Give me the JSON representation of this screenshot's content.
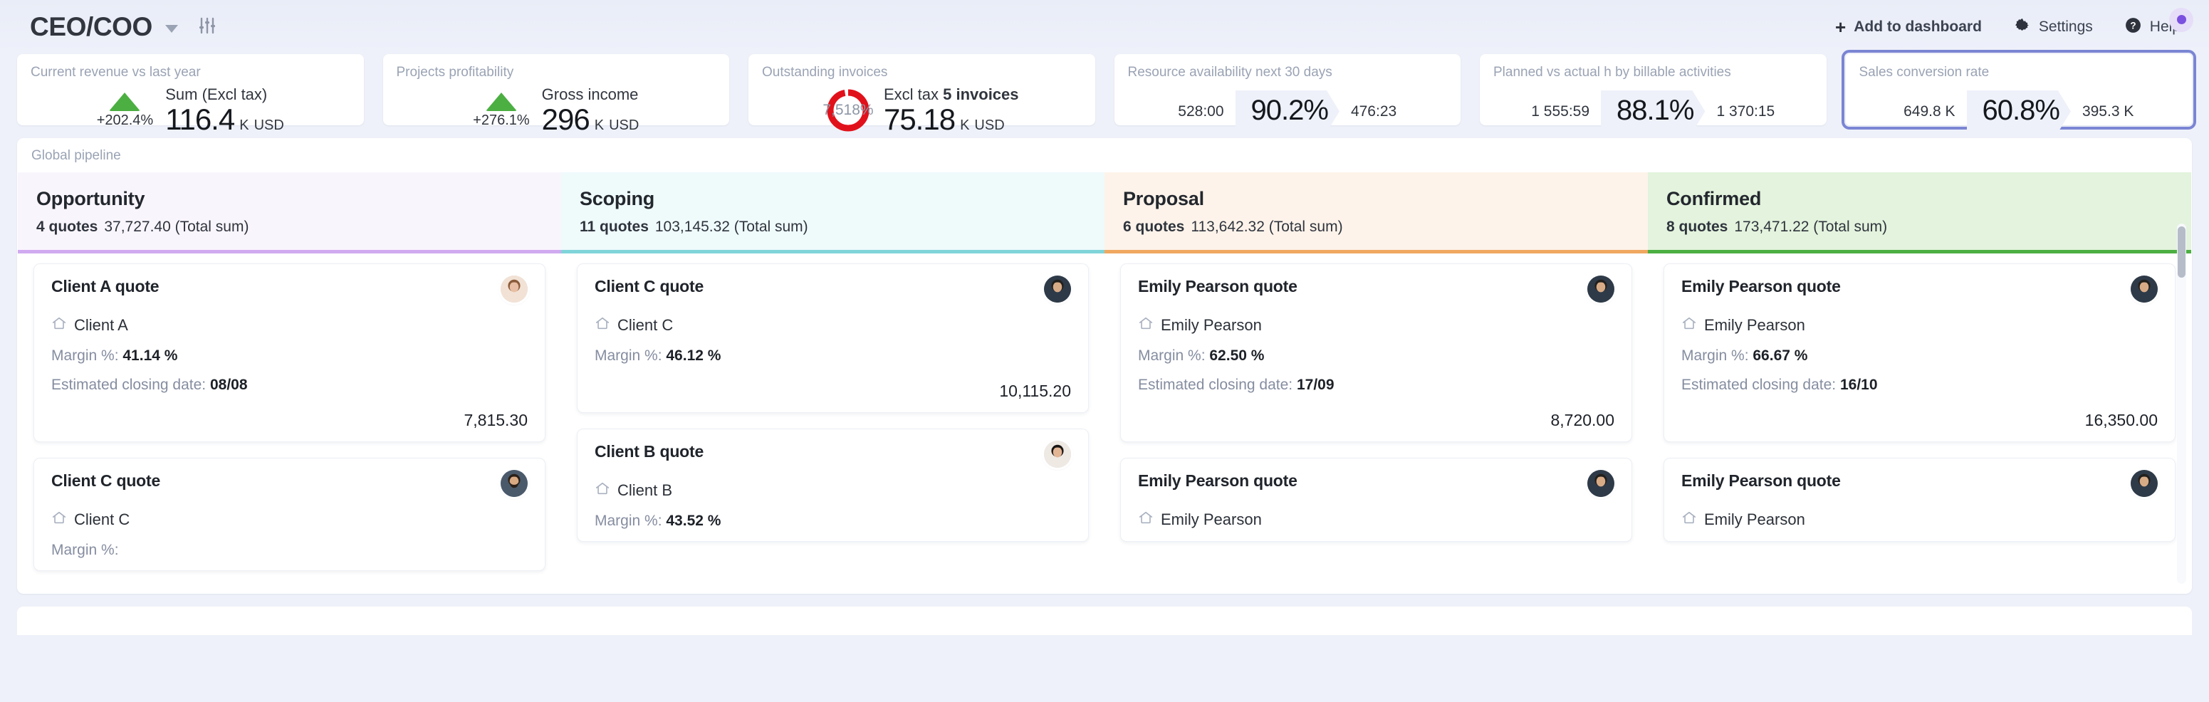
{
  "header": {
    "title": "CEO/COO",
    "dropdown_icon": "chevron-down-icon",
    "filters_icon": "sliders-icon",
    "actions": [
      {
        "label": "Add to dashboard",
        "icon": "plus-icon"
      },
      {
        "label": "Settings",
        "icon": "gear-icon"
      },
      {
        "label": "Help",
        "icon": "help-circle-icon"
      }
    ],
    "notification_dot_color": "#7b4fe0"
  },
  "kpis": [
    {
      "title": "Current revenue vs last year",
      "type": "trend",
      "trend_direction": "up",
      "trend_value": "+202.4%",
      "trend_color": "#4caf42",
      "sub_label": "Sum (Excl tax)",
      "value": "116.4",
      "unit": "K",
      "currency": "USD",
      "selected": false
    },
    {
      "title": "Projects profitability",
      "type": "trend",
      "trend_direction": "up",
      "trend_value": "+276.1%",
      "trend_color": "#4caf42",
      "sub_label": "Gross income",
      "value": "296",
      "unit": "K",
      "currency": "USD",
      "selected": false
    },
    {
      "title": "Outstanding invoices",
      "type": "donut",
      "donut_label": "7,518%",
      "donut_color": "#e1111b",
      "donut_percent": 97,
      "sub_prefix": "Excl tax",
      "sub_strong": "5 invoices",
      "value": "75.18",
      "unit": "K",
      "currency": "USD",
      "selected": false
    },
    {
      "title": "Resource availability next 30 days",
      "type": "ratio",
      "left": "528:00",
      "center": "90.2%",
      "right": "476:23",
      "selected": false
    },
    {
      "title": "Planned vs actual h by billable activities",
      "type": "ratio",
      "left": "1 555:59",
      "center": "88.1%",
      "right": "1 370:15",
      "selected": false
    },
    {
      "title": "Sales conversion rate",
      "type": "ratio",
      "left": "649.8 K",
      "center": "60.8%",
      "right": "395.3 K",
      "selected": true,
      "selection_color": "#7b85d4"
    }
  ],
  "pipeline": {
    "label": "Global pipeline",
    "total_sum_suffix": "(Total sum)",
    "quotes_suffix": "quotes",
    "stages": [
      {
        "name": "Opportunity",
        "quotes": "4 quotes",
        "total": "37,727.40 (Total sum)",
        "bg": "#f9f5fd",
        "accent": "#d0aaf0",
        "cards": [
          {
            "title": "Client A quote",
            "client": "Client A",
            "margin_label": "Margin %:",
            "margin_value": "41.14 %",
            "date_label": "Estimated closing date:",
            "date_value": "08/08",
            "amount": "7,815.30",
            "avatar": "woman-brown-hair"
          },
          {
            "title": "Client C quote",
            "client": "Client C",
            "margin_label": "Margin %:",
            "margin_value": "",
            "date_label": "",
            "date_value": "",
            "amount": "",
            "avatar": "man-beard"
          }
        ]
      },
      {
        "name": "Scoping",
        "quotes": "11 quotes",
        "total": "103,145.32 (Total sum)",
        "bg": "#effafb",
        "accent": "#7fd4d9",
        "cards": [
          {
            "title": "Client C quote",
            "client": "Client C",
            "margin_label": "Margin %:",
            "margin_value": "46.12 %",
            "date_label": "",
            "date_value": "",
            "amount": "10,115.20",
            "avatar": "man-suit-dark"
          },
          {
            "title": "Client B quote",
            "client": "Client B",
            "margin_label": "Margin %:",
            "margin_value": "43.52 %",
            "date_label": "",
            "date_value": "",
            "amount": "",
            "avatar": "woman-dark-hair"
          }
        ]
      },
      {
        "name": "Proposal",
        "quotes": "6 quotes",
        "total": "113,642.32 (Total sum)",
        "bg": "#fdf3ea",
        "accent": "#f0a861",
        "cards": [
          {
            "title": "Emily Pearson quote",
            "client": "Emily Pearson",
            "margin_label": "Margin %:",
            "margin_value": "62.50 %",
            "date_label": "Estimated closing date:",
            "date_value": "17/09",
            "amount": "8,720.00",
            "avatar": "man-suit-dark"
          },
          {
            "title": "Emily Pearson quote",
            "client": "Emily Pearson",
            "margin_label": "",
            "margin_value": "",
            "date_label": "",
            "date_value": "",
            "amount": "",
            "avatar": "man-suit-dark"
          }
        ]
      },
      {
        "name": "Confirmed",
        "quotes": "8 quotes",
        "total": "173,471.22 (Total sum)",
        "bg": "#e3f3dd",
        "accent": "#4caf42",
        "cards": [
          {
            "title": "Emily Pearson quote",
            "client": "Emily Pearson",
            "margin_label": "Margin %:",
            "margin_value": "66.67 %",
            "date_label": "Estimated closing date:",
            "date_value": "16/10",
            "amount": "16,350.00",
            "avatar": "man-suit-dark"
          },
          {
            "title": "Emily Pearson quote",
            "client": "Emily Pearson",
            "margin_label": "",
            "margin_value": "",
            "date_label": "",
            "date_value": "",
            "amount": "",
            "avatar": "man-suit-dark"
          }
        ]
      }
    ]
  }
}
